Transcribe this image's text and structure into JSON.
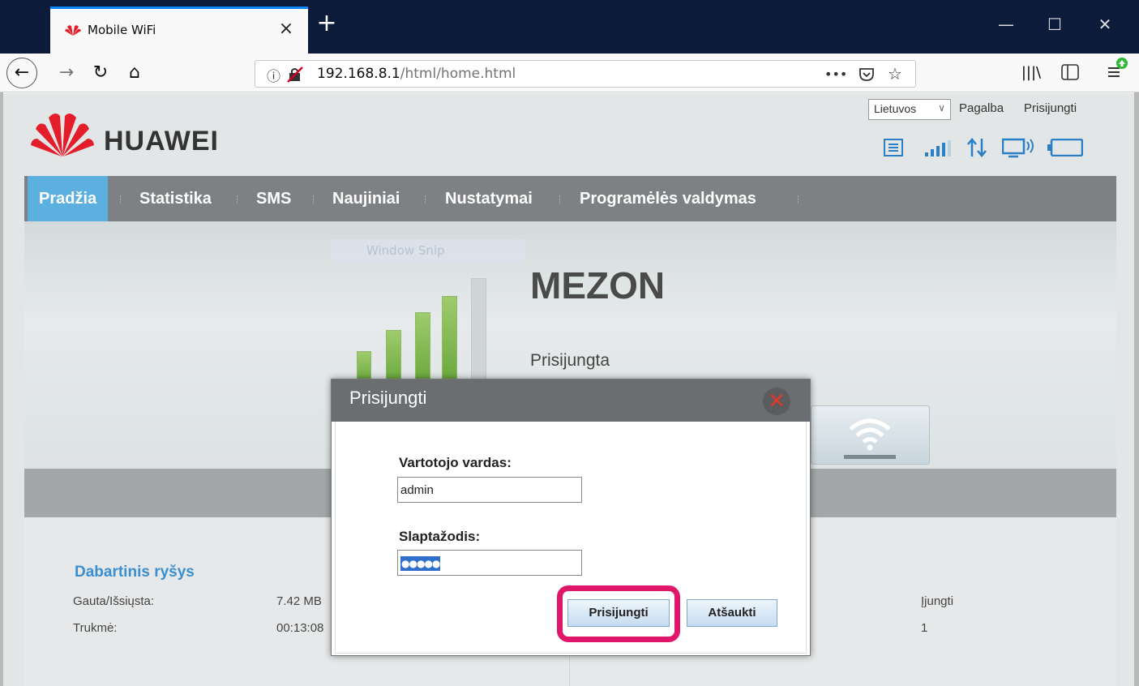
{
  "browser": {
    "tab_title": "Mobile WiFi",
    "tab_close": "×",
    "new_tab": "+",
    "window_controls": {
      "minimize": "—",
      "maximize": "☐",
      "close": "✕"
    },
    "url_host": "192.168.8.1",
    "url_path": "/html/home.html",
    "url_more": "•••",
    "icons": [
      "back-icon",
      "forward-icon",
      "reload-icon",
      "home-icon",
      "info-icon",
      "insecure-lock-icon",
      "pocket-icon",
      "bookmark-star-icon",
      "library-icon",
      "sidebar-icon",
      "menu-update-icon"
    ]
  },
  "header": {
    "brand": "HUAWEI",
    "brand_color": "#e41d2b",
    "language": "Lietuvos",
    "help_link": "Pagalba",
    "login_link": "Prisijungti",
    "status_icons": [
      "sms-icon",
      "signal-icon",
      "data-transfer-icon",
      "wifi-clients-icon",
      "battery-icon"
    ],
    "icon_color": "#2b7fc6"
  },
  "menu": {
    "items": [
      {
        "label": "Pradžia",
        "active": true
      },
      {
        "label": "Statistika",
        "active": false
      },
      {
        "label": "SMS",
        "active": false
      },
      {
        "label": "Naujiniai",
        "active": false
      },
      {
        "label": "Nustatymai",
        "active": false
      },
      {
        "label": "Programėlės valdymas",
        "active": false
      }
    ],
    "active_color": "#5bb0e0"
  },
  "hero": {
    "snip_text": "Window Snip",
    "operator": "MEZON",
    "connection_status": "Prisijungta",
    "signal_level": 4,
    "signal_max": 5
  },
  "info": {
    "section_title": "Dabartinis ryšys",
    "rows": [
      {
        "label": "Gauta/Išsiųsta:",
        "value": "7.42 MB",
        "right_value": "Įjungti"
      },
      {
        "label": "Trukmė:",
        "value": "00:13:08",
        "right_value": "1"
      }
    ]
  },
  "login_dialog": {
    "title": "Prisijungti",
    "close_symbol": "✕",
    "username_label": "Vartotojo vardas:",
    "username_value": "admin",
    "password_label": "Slaptažodis:",
    "password_masked": "●●●●●",
    "submit_label": "Prisijungti",
    "cancel_label": "Atšaukti",
    "highlight_color": "#e0166a"
  }
}
